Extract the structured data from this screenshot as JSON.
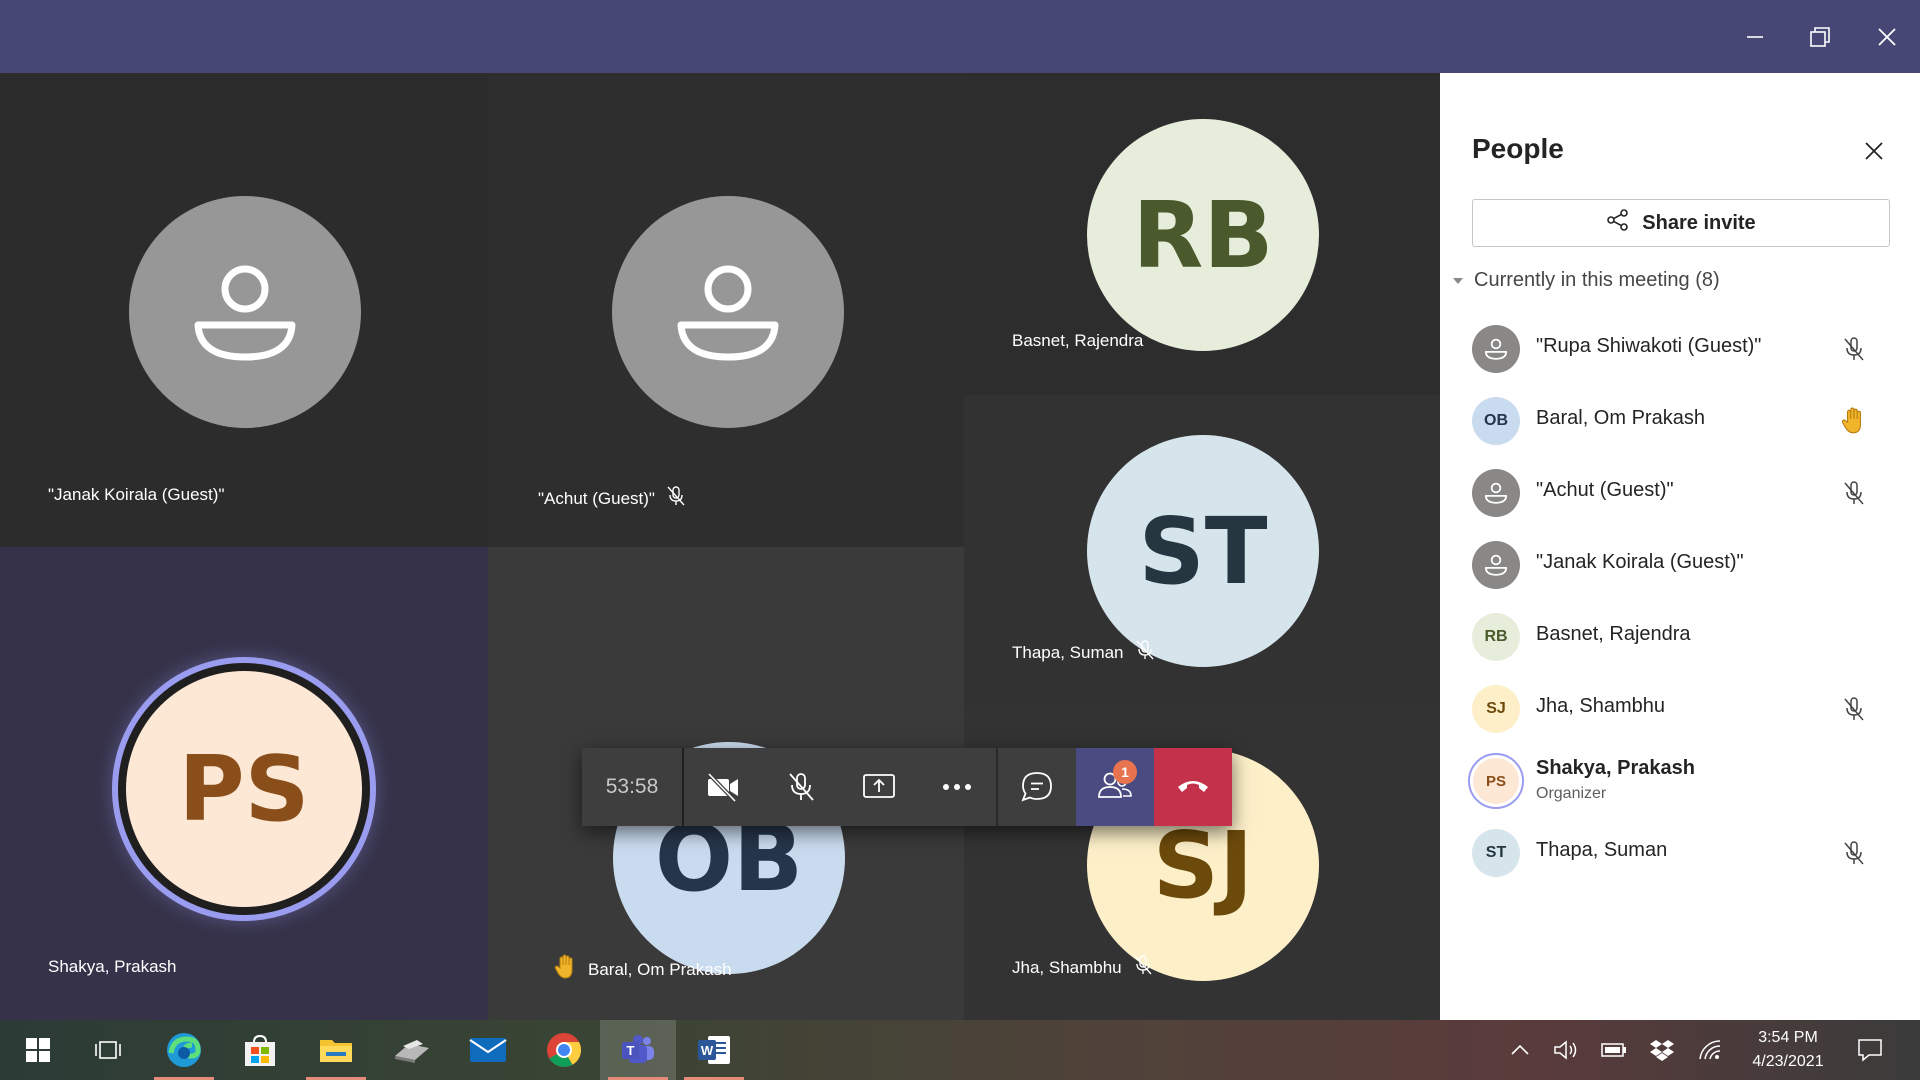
{
  "window": {
    "controls": [
      "minimize-icon",
      "restore-icon",
      "close-icon"
    ]
  },
  "tiles": [
    {
      "id": "janak",
      "name": "\"Janak Koirala (Guest)\"",
      "icon": "person-icon",
      "muted": false
    },
    {
      "id": "achut",
      "name": "\"Achut (Guest)\"",
      "icon": "person-icon",
      "muted": true
    },
    {
      "id": "basnet",
      "name": "Basnet, Rajendra",
      "initials": "RB",
      "muted": false
    },
    {
      "id": "thapa",
      "name": "Thapa, Suman",
      "initials": "ST",
      "muted": true
    },
    {
      "id": "shakya",
      "name": "Shakya, Prakash",
      "initials": "PS",
      "speaking": true
    },
    {
      "id": "baral",
      "name": "Baral, Om Prakash",
      "initials": "OB",
      "hand_raised": true
    },
    {
      "id": "jha",
      "name": "Jha, Shambhu",
      "initials": "SJ",
      "muted": true
    }
  ],
  "callbar": {
    "timer": "53:58",
    "buttons": [
      "camera-off-icon",
      "mic-off-icon",
      "share-screen-icon",
      "more-icon",
      "chat-icon",
      "people-icon",
      "hang-up-icon"
    ],
    "people_badge": "1"
  },
  "panel": {
    "title": "People",
    "share_label": "Share invite",
    "section_label": "Currently in this meeting (8)",
    "participants": [
      {
        "name": "\"Rupa Shiwakoti (Guest)\"",
        "avatar": "person-icon",
        "status": "mic-off-icon"
      },
      {
        "name": "Baral, Om Prakash",
        "initials": "OB",
        "status": "raised-hand-icon"
      },
      {
        "name": "\"Achut (Guest)\"",
        "avatar": "person-icon",
        "status": "mic-off-icon"
      },
      {
        "name": "\"Janak Koirala (Guest)\"",
        "avatar": "person-icon",
        "status": ""
      },
      {
        "name": "Basnet, Rajendra",
        "initials": "RB",
        "status": ""
      },
      {
        "name": "Jha, Shambhu",
        "initials": "SJ",
        "status": "mic-off-icon"
      },
      {
        "name": "Shakya, Prakash",
        "initials": "PS",
        "role": "Organizer",
        "status": ""
      },
      {
        "name": "Thapa, Suman",
        "initials": "ST",
        "status": "mic-off-icon"
      }
    ]
  },
  "taskbar": {
    "apps": [
      "windows-start-icon",
      "task-view-icon",
      "edge-icon",
      "store-icon",
      "file-explorer-icon",
      "scanner-icon",
      "mail-icon",
      "chrome-icon",
      "teams-icon",
      "word-icon"
    ],
    "tray": [
      "chevron-up-icon",
      "volume-icon",
      "battery-icon",
      "dropbox-icon",
      "wifi-icon",
      "notifications-icon"
    ],
    "time": "3:54 PM",
    "date": "4/23/2021"
  },
  "colors": {
    "titlebar": "#464775",
    "avatar_rb_bg": "#e6eedb",
    "avatar_rb_fg": "#4a5a2c",
    "avatar_st_bg": "#d6e4ec",
    "avatar_st_fg": "#263640",
    "avatar_ps_bg": "#fde7d5",
    "avatar_ps_fg": "#8a4e1a",
    "avatar_ob_bg": "#c9dbee",
    "avatar_ob_fg": "#25364a",
    "avatar_sj_bg": "#fdf0c9",
    "avatar_sj_fg": "#6c4a0b",
    "speaking_ring": "#9a9cf0",
    "hangup": "#c4314b"
  }
}
